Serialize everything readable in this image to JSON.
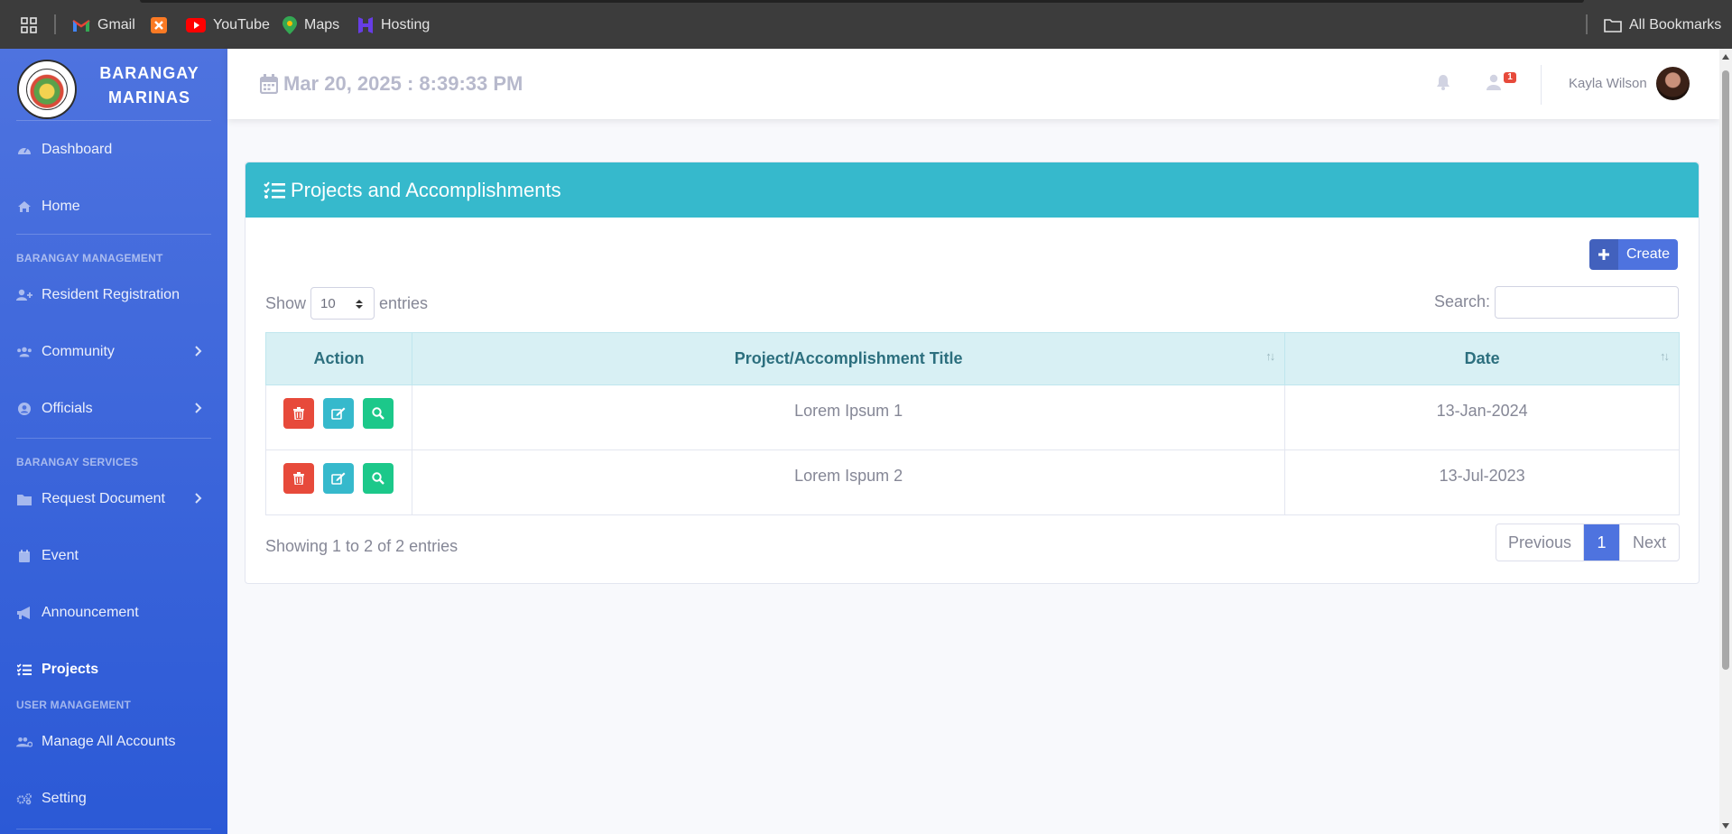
{
  "bookmarks": {
    "items": [
      {
        "label": "Gmail",
        "icon": "gmail-icon"
      },
      {
        "label": "",
        "icon": "xampp-icon"
      },
      {
        "label": "YouTube",
        "icon": "youtube-icon"
      },
      {
        "label": "Maps",
        "icon": "maps-icon"
      },
      {
        "label": "Hosting",
        "icon": "hostinger-icon"
      }
    ],
    "all_bookmarks": "All Bookmarks"
  },
  "sidebar": {
    "brand_line1": "BARANGAY",
    "brand_line2": "MARINAS",
    "items": [
      {
        "label": "Dashboard",
        "icon": "tachometer-icon"
      },
      {
        "label": "Home",
        "icon": "home-icon"
      },
      {
        "label": "Resident Registration",
        "icon": "user-plus-icon"
      },
      {
        "label": "Community",
        "icon": "users-icon"
      },
      {
        "label": "Officials",
        "icon": "user-circle-icon"
      },
      {
        "label": "Request Document",
        "icon": "folder-icon"
      },
      {
        "label": "Event",
        "icon": "calendar-icon"
      },
      {
        "label": "Announcement",
        "icon": "bullhorn-icon"
      },
      {
        "label": "Projects",
        "icon": "tasks-icon"
      },
      {
        "label": "Manage All Accounts",
        "icon": "users-cog-icon"
      },
      {
        "label": "Setting",
        "icon": "cogs-icon"
      }
    ],
    "headings": [
      "BARANGAY MANAGEMENT",
      "BARANGAY SERVICES",
      "USER MANAGEMENT"
    ]
  },
  "topbar": {
    "datetime": "Mar 20, 2025 :  8:39:33 PM",
    "badge_count": "1",
    "username": "Kayla Wilson"
  },
  "card": {
    "title": "Projects and Accomplishments",
    "create_label": "Create",
    "show_label": "Show",
    "entries_value": "10",
    "entries_label": "entries",
    "search_label": "Search:",
    "columns": [
      "Action",
      "Project/Accomplishment Title",
      "Date"
    ],
    "rows": [
      {
        "title": "Lorem Ipsum 1",
        "date": "13-Jan-2024"
      },
      {
        "title": "Lorem Ispum 2",
        "date": "13-Jul-2023"
      }
    ],
    "info": "Showing 1 to 2 of 2 entries",
    "pager": {
      "previous": "Previous",
      "current": "1",
      "next": "Next"
    }
  },
  "colors": {
    "sidebar": "#4e73df",
    "header": "#36b9cc",
    "danger": "#e74a3b",
    "success": "#1cc88a"
  }
}
